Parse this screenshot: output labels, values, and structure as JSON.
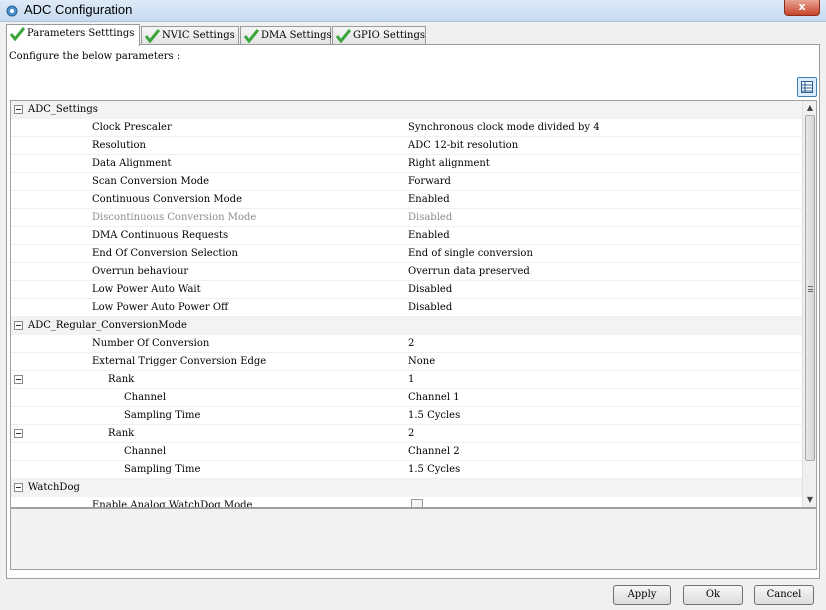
{
  "window": {
    "title": "ADC Configuration",
    "close_label": "x"
  },
  "tabs": [
    {
      "label": "Parameters Setttings",
      "active": true
    },
    {
      "label": "NVIC Settings",
      "active": false
    },
    {
      "label": "DMA Settings",
      "active": false
    },
    {
      "label": "GPIO Settings",
      "active": false
    }
  ],
  "description": "Configure the below parameters :",
  "tree": {
    "groups": {
      "adc_settings": "ADC_Settings",
      "regular_conversion": "ADC_Regular_ConversionMode",
      "watchdog": "WatchDog"
    },
    "adc_settings": [
      {
        "name": "Clock Prescaler",
        "value": "Synchronous clock mode divided by 4"
      },
      {
        "name": "Resolution",
        "value": "ADC 12-bit resolution"
      },
      {
        "name": "Data Alignment",
        "value": "Right alignment"
      },
      {
        "name": "Scan Conversion Mode",
        "value": "Forward"
      },
      {
        "name": "Continuous Conversion Mode",
        "value": "Enabled"
      },
      {
        "name": "Discontinuous Conversion Mode",
        "value": "Disabled",
        "disabled": true
      },
      {
        "name": "DMA Continuous Requests",
        "value": "Enabled"
      },
      {
        "name": "End Of Conversion Selection",
        "value": "End of single conversion"
      },
      {
        "name": "Overrun behaviour",
        "value": "Overrun data preserved"
      },
      {
        "name": "Low Power Auto Wait",
        "value": "Disabled"
      },
      {
        "name": "Low Power Auto Power Off",
        "value": "Disabled"
      }
    ],
    "regular": {
      "number_of_conversion": {
        "name": "Number Of Conversion",
        "value": "2"
      },
      "external_trigger": {
        "name": "External Trigger Conversion Edge",
        "value": "None"
      },
      "ranks": [
        {
          "name": "Rank",
          "value": "1",
          "channel": {
            "name": "Channel",
            "value": "Channel 1"
          },
          "sampling": {
            "name": "Sampling Time",
            "value": "1.5 Cycles"
          }
        },
        {
          "name": "Rank",
          "value": "2",
          "channel": {
            "name": "Channel",
            "value": "Channel 2"
          },
          "sampling": {
            "name": "Sampling Time",
            "value": "1.5 Cycles"
          }
        }
      ]
    },
    "watchdog": {
      "enable_label": "Enable Analog WatchDog Mode",
      "enabled": false
    }
  },
  "buttons": {
    "apply": "Apply",
    "ok": "Ok",
    "cancel": "Cancel"
  },
  "colors": {
    "check_green": "#3aa53a",
    "accent_blue": "#3c7fb1"
  }
}
